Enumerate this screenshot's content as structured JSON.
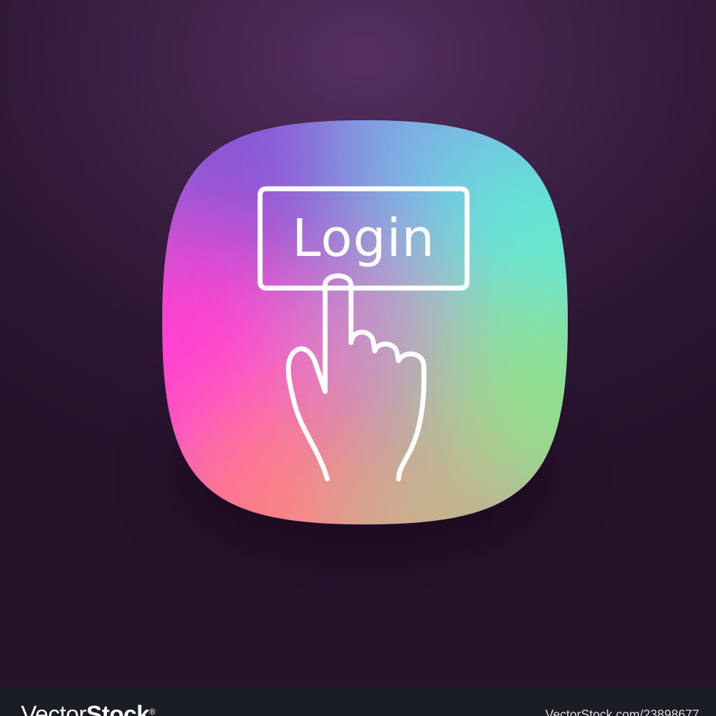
{
  "icon": {
    "name": "login-hand-icon",
    "label": "Login",
    "colors": {
      "background_top": "#552f60",
      "background_bottom": "#26122b",
      "gradient_magenta": "#ff3fd0",
      "gradient_purple": "#8a56d6",
      "gradient_blue": "#7ab2e6",
      "gradient_cyan": "#5fe8d6",
      "gradient_green": "#8ee08f",
      "gradient_coral": "#ff7a86",
      "stroke": "#ffffff"
    }
  },
  "footer": {
    "brand_light": "Vector",
    "brand_bold": "Stock",
    "brand_mark": "®",
    "url": "VectorStock.com/23898677"
  }
}
